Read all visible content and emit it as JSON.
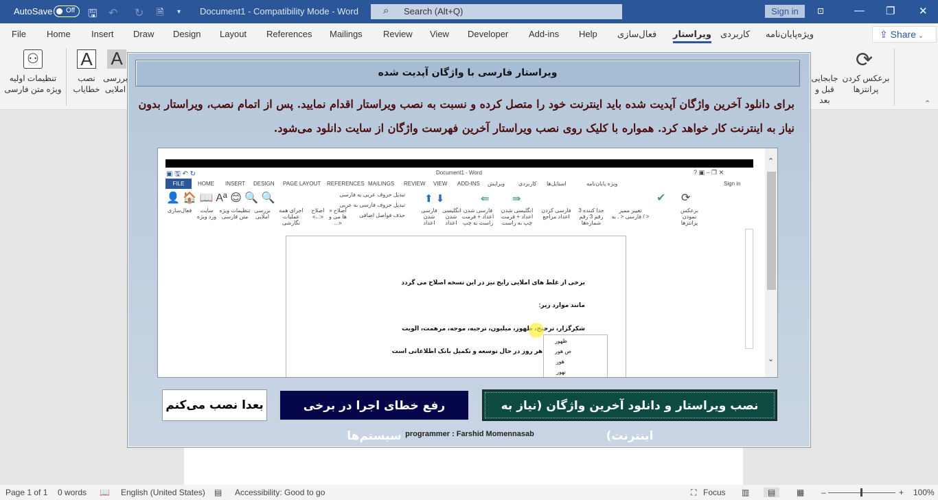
{
  "titlebar": {
    "autosave": "AutoSave",
    "autosave_state": "Off",
    "title": "Document1  -  Compatibility Mode  -  Word",
    "search_placeholder": "Search (Alt+Q)",
    "signin": "Sign in",
    "accent": "#2b579a"
  },
  "tabs": [
    "File",
    "Home",
    "Insert",
    "Draw",
    "Design",
    "Layout",
    "References",
    "Mailings",
    "Review",
    "View",
    "Developer",
    "Add-ins",
    "Help",
    "فعال‌سازی",
    "ویراستار",
    "کاربردی",
    "ویژه‌پایان‌نامه"
  ],
  "active_tab": "ویراستار",
  "share": "Share",
  "ribbon": {
    "left": [
      {
        "label": "تنظیمات اولیه ویژه متن فارسی"
      },
      {
        "label": "نصب خطایاب"
      },
      {
        "label": "بررسی املایی"
      }
    ],
    "right": [
      {
        "label": "برعکس کردن پرانتزها"
      },
      {
        "label": "جابجایی قبل و بعد"
      }
    ]
  },
  "dialog": {
    "title": "ویراستار فارسی با واژگان آپدیت شده",
    "line1": "برای دانلود آخرین واژگان آپدیت شده باید اینترنت خود را متصل کرده و نسبت به نصب ویراستار اقدام نمایید. پس از اتمام نصب، ویراستار بدون",
    "line2": "نیاز به اینترنت کار خواهد کرد. همواره با کلیک روی نصب ویراستار آخرین فهرست واژگان از سایت دانلود می‌شود.",
    "btn_install": "نصب ویراستار و دانلود آخرین واژگان (نیاز به اینترنت)",
    "btn_fix": "رفع خطای اجرا در برخی سیستم‌ها",
    "btn_later": "بعدا نصب می‌کنم",
    "programmer": "programmer :  Farshid  Momennasab",
    "colors": {
      "install": "#0d4a3f",
      "fix": "#06064a",
      "later": "#ffffff"
    }
  },
  "screenshot": {
    "title": "Document1 - Word",
    "signin": "Sign in",
    "tabs": [
      "FILE",
      "HOME",
      "INSERT",
      "DESIGN",
      "PAGE LAYOUT",
      "REFERENCES",
      "MAILINGS",
      "REVIEW",
      "VIEW",
      "ADD-INS",
      "ویرایش",
      "کاربردی",
      "استایل‌ها",
      "ویژه پایان‌نامه"
    ],
    "buttons": [
      "فعال‌سازی",
      "سایت ورد ویژه",
      "تنظیمات ویژه متن فارسی",
      "بررسی املایی",
      "اجرای همه عملیات نگارشی",
      "اصلاح «،.:»",
      "اصلاح « ها می و ...»",
      "تبدیل حروف عربی به فارسی",
      "تبدیل حروف فارسی به عربی",
      "حذف فواصل اضافی",
      "فارسی شدن اعداد",
      "انگلیسی شدن اعداد",
      "فارسی شدن اعداد + فرمت راست به چپ",
      "انگلیسی شدن اعداد + فرمت چپ به راست",
      "فارسی کردن اعداد مراجع",
      "جدا کننده 3 رقم 3 رقم شماره‌ها",
      "تغییر ممیز فارسی < . به / >",
      "برعکس نمودن پرانتزها"
    ],
    "doc_lines": [
      "برخی از غلط های املایی رایج نیز در این نسخه اصلاح می گردد",
      "مانند موارد زیر:",
      "شکرگزار، ترجیح، ظهور، میلیون، ترجیه، موجه، مرهمت، الویت",
      "...ارت دیگر که هر روز در حال توسعه و تکمیل بانک اطلاعاتی است"
    ],
    "suggestions": [
      "ظهور",
      "ص هور",
      "هور",
      "نهور"
    ]
  },
  "status": {
    "page": "Page 1 of 1",
    "words": "0 words",
    "language": "English (United States)",
    "accessibility": "Accessibility: Good to go",
    "focus": "Focus",
    "zoom": "100%"
  }
}
